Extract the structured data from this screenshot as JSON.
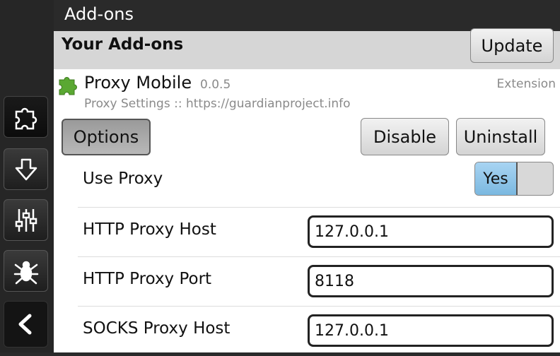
{
  "window": {
    "title": "Add-ons"
  },
  "sidebar": {
    "items": [
      {
        "icon": "puzzle-icon",
        "active": true
      },
      {
        "icon": "download-arrow-icon",
        "active": false
      },
      {
        "icon": "sliders-icon",
        "active": false
      },
      {
        "icon": "bug-icon",
        "active": false
      }
    ],
    "back_icon": "chevron-left-icon"
  },
  "section": {
    "title": "Your Add-ons",
    "update_label": "Update"
  },
  "addon": {
    "name": "Proxy Mobile",
    "version": "0.0.5",
    "type": "Extension",
    "description": "Proxy Settings :: https://guardianproject.info",
    "options_label": "Options",
    "disable_label": "Disable",
    "uninstall_label": "Uninstall",
    "icon": "puzzle-piece-icon",
    "icon_color": "#5aa832"
  },
  "prefs": {
    "use_proxy": {
      "label": "Use Proxy",
      "toggle_on_label": "Yes",
      "value": true
    },
    "http_host": {
      "label": "HTTP Proxy Host",
      "value": "127.0.0.1"
    },
    "http_port": {
      "label": "HTTP Proxy Port",
      "value": "8118"
    },
    "socks_host": {
      "label": "SOCKS Proxy Host",
      "value": "127.0.0.1"
    }
  },
  "colors": {
    "toggle_on": "#8cc4ea",
    "header_bg": "#d6d6d6",
    "chrome_bg": "#2a2a2a"
  }
}
